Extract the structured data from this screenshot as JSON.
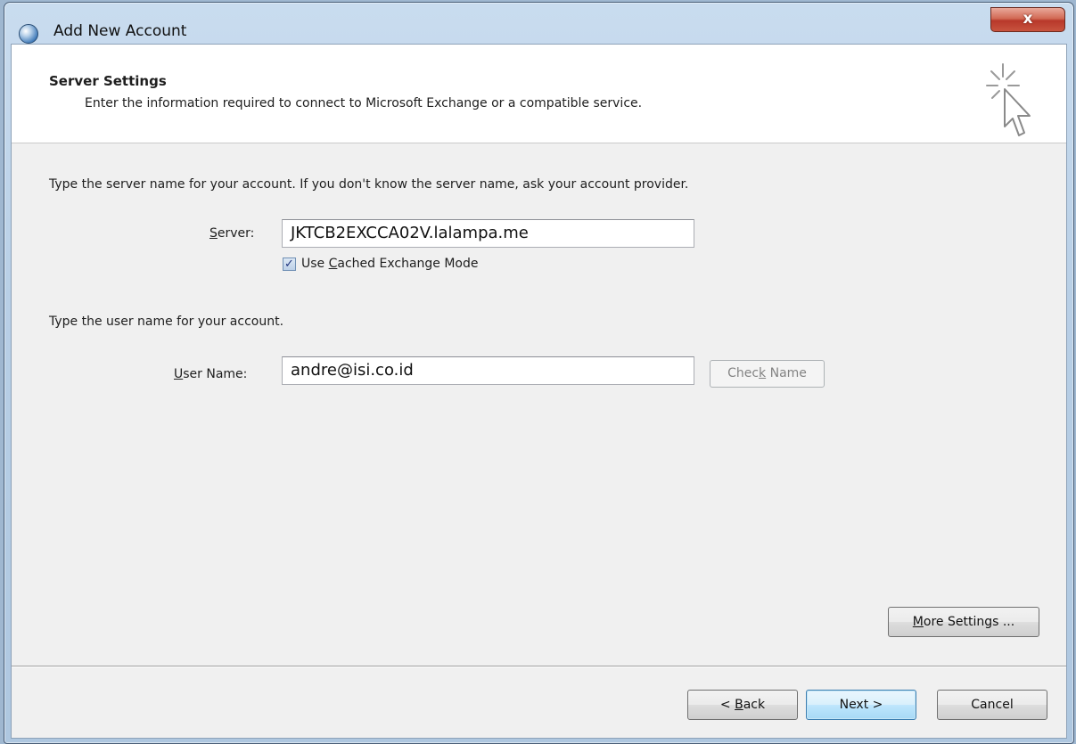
{
  "window": {
    "title": "Add New Account",
    "close_label": "x"
  },
  "header": {
    "title": "Server Settings",
    "subtitle": "Enter the information required to connect to Microsoft Exchange or a compatible service."
  },
  "server_section": {
    "instruction": "Type the server name for your account. If you don't know the server name, ask your account provider.",
    "server_label_accel": "S",
    "server_label_rest": "erver:",
    "server_value": "JKTCB2EXCCA02V.lalampa.me",
    "cached_mode_checked": true,
    "cached_mode_pre": "Use ",
    "cached_mode_accel": "C",
    "cached_mode_rest": "ached Exchange Mode"
  },
  "user_section": {
    "instruction": "Type the user name for your account.",
    "user_label_accel": "U",
    "user_label_rest": "ser Name:",
    "user_value": "andre@isi.co.id",
    "check_name_pre": "Chec",
    "check_name_accel": "k",
    "check_name_rest": " Name"
  },
  "buttons": {
    "more_settings_accel": "M",
    "more_settings_rest": "ore Settings ...",
    "back_pre": "< ",
    "back_accel": "B",
    "back_rest": "ack",
    "next_label": "Next >",
    "cancel_label": "Cancel"
  },
  "icons": {
    "app": "outlook-globe-icon",
    "wizard": "cursor-sparkle-icon"
  }
}
